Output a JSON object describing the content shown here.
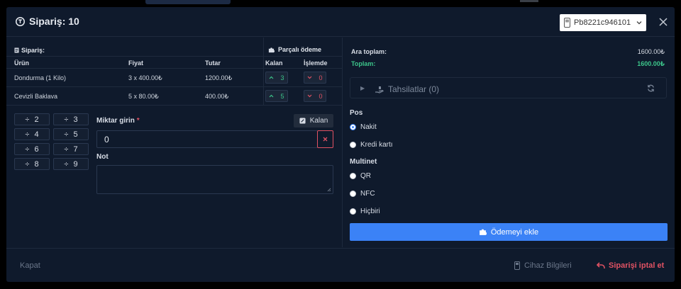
{
  "header": {
    "title": "Sipariş: 10",
    "device": "Pb8221c946101"
  },
  "order_table": {
    "caption": "Sipariş:",
    "split_caption": "Parçalı ödeme",
    "columns": [
      "Ürün",
      "Fiyat",
      "Tutar",
      "Kalan",
      "İşlemde"
    ],
    "rows": [
      {
        "product": "Dondurma (1 Kilo)",
        "price": "3 x 400.00₺",
        "total": "1200.00₺",
        "kalan": "3",
        "islemde": "0"
      },
      {
        "product": "Cevizli Baklava",
        "price": "5 x 80.00₺",
        "total": "400.00₺",
        "kalan": "5",
        "islemde": "0"
      }
    ]
  },
  "divide_buttons": [
    "2",
    "3",
    "4",
    "5",
    "6",
    "7",
    "8",
    "9"
  ],
  "amount": {
    "label": "Miktar girin",
    "required_mark": "*",
    "value": "0",
    "kalan_button": "Kalan"
  },
  "note": {
    "label": "Not"
  },
  "summary": {
    "subtotal_label": "Ara toplam:",
    "subtotal_value": "1600.00₺",
    "total_label": "Toplam:",
    "total_value": "1600.00₺"
  },
  "collections": {
    "title": "Tahsilatlar (0)"
  },
  "payment": {
    "pos_title": "Pos",
    "pos_options": [
      "Nakit",
      "Kredi kartı"
    ],
    "multinet_title": "Multinet",
    "multinet_options": [
      "QR",
      "NFC",
      "Hiçbiri"
    ],
    "add_button": "Ödemeyi ekle"
  },
  "footer": {
    "close": "Kapat",
    "device_info": "Cihaz Bilgileri",
    "cancel_order": "Siparişi iptal et"
  },
  "colors": {
    "accent": "#3b82f6",
    "success": "#3cc58a",
    "danger": "#e05263",
    "modal_bg": "#0f1a2c"
  }
}
